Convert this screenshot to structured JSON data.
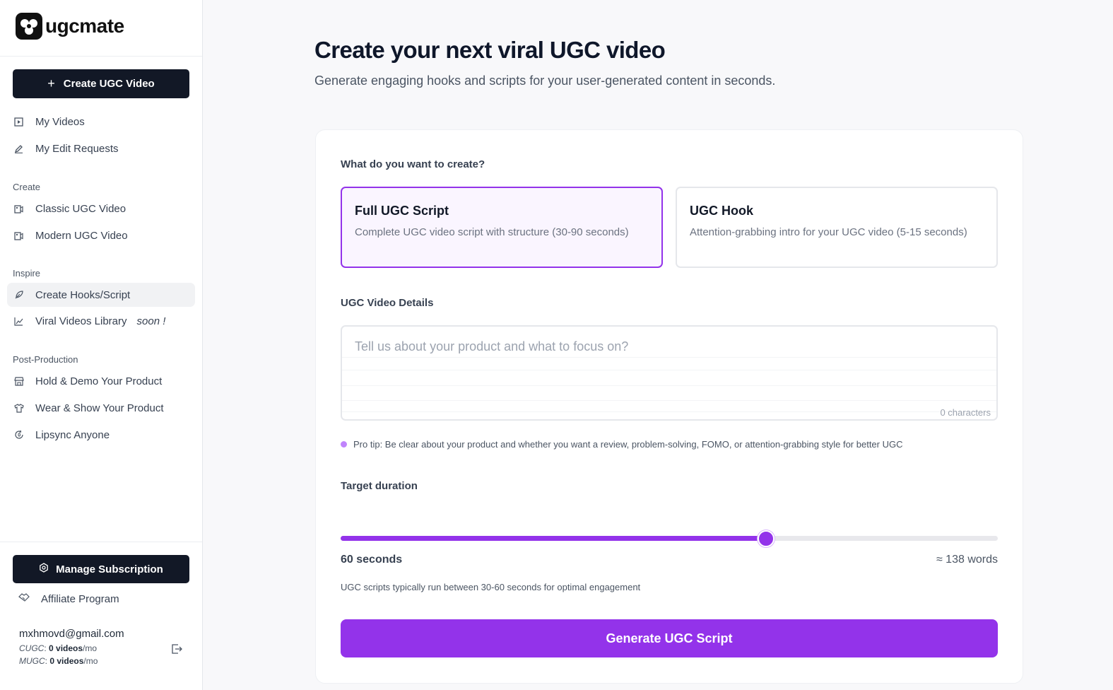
{
  "brand": {
    "name": "ugcmate"
  },
  "sidebar": {
    "create_button": "Create UGC Video",
    "top_items": [
      {
        "label": "My Videos",
        "icon": "play-square-icon"
      },
      {
        "label": "My Edit Requests",
        "icon": "pencil-icon"
      }
    ],
    "sections": [
      {
        "label": "Create",
        "items": [
          {
            "label": "Classic UGC Video",
            "icon": "film-icon"
          },
          {
            "label": "Modern UGC Video",
            "icon": "film-icon"
          }
        ]
      },
      {
        "label": "Inspire",
        "items": [
          {
            "label": "Create Hooks/Script",
            "icon": "feather-icon",
            "active": true
          },
          {
            "label": "Viral Videos Library",
            "icon": "chart-line-icon",
            "badge": "soon !"
          }
        ]
      },
      {
        "label": "Post-Production",
        "items": [
          {
            "label": "Hold & Demo Your Product",
            "icon": "store-icon"
          },
          {
            "label": "Wear & Show Your Product",
            "icon": "shirt-icon"
          },
          {
            "label": "Lipsync Anyone",
            "icon": "refresh-mic-icon"
          }
        ]
      }
    ],
    "manage_subscription": "Manage Subscription",
    "affiliate": "Affiliate Program",
    "account": {
      "email": "mxhmovd@gmail.com",
      "quotas": [
        {
          "name": "CUGC",
          "value": "0 videos",
          "unit": "/mo"
        },
        {
          "name": "MUGC",
          "value": "0 videos",
          "unit": "/mo"
        }
      ]
    }
  },
  "main": {
    "title": "Create your next viral UGC video",
    "subtitle": "Generate engaging hooks and scripts for your user-generated content in seconds.",
    "question": "What do you want to create?",
    "options": [
      {
        "title": "Full UGC Script",
        "desc": "Complete UGC video script with structure (30-90 seconds)",
        "selected": true
      },
      {
        "title": "UGC Hook",
        "desc": "Attention-grabbing intro for your UGC video (5-15 seconds)",
        "selected": false
      }
    ],
    "details_label": "UGC Video Details",
    "details_placeholder": "Tell us about your product and what to focus on?",
    "char_count": "0 characters",
    "tip": "Pro tip: Be clear about your product and whether you want a review, problem-solving, FOMO, or attention-grabbing style for better UGC",
    "duration_label": "Target duration",
    "duration": {
      "value": 60,
      "min": 5,
      "max": 90,
      "display": "60 seconds",
      "words": "≈ 138 words"
    },
    "duration_hint": "UGC scripts typically run between 30-60 seconds for optimal engagement",
    "generate_button": "Generate UGC Script"
  },
  "colors": {
    "accent": "#9333ea",
    "dark": "#121826",
    "selected_bg": "#faf5ff"
  }
}
